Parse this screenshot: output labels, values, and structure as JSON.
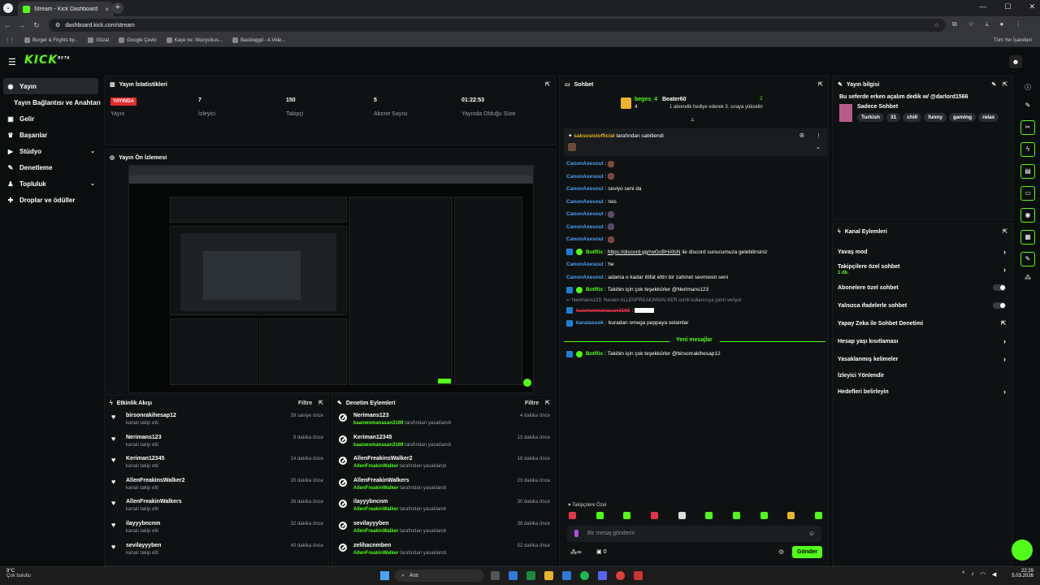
{
  "browser": {
    "tab_title": "Stream - Kick Dashboard",
    "url": "dashboard.kick.com/stream",
    "bookmarks": [
      "Burger & Frights by...",
      "Gözat",
      "Google Çeviri",
      "Kaçe ne: Xkurycikus...",
      "Backloggd - A Vide..."
    ],
    "all_bookmarks": "Tüm Yer İşaretleri"
  },
  "kick": {
    "logo": "KICK",
    "logo_sup": "BETA"
  },
  "sidebar": {
    "items": [
      {
        "label": "Yayın",
        "icon": "broadcast-icon"
      },
      {
        "label": "Yayın Bağlantısı ve Anahtarı"
      },
      {
        "label": "Gelir",
        "icon": "wallet-icon"
      },
      {
        "label": "Başarılar",
        "icon": "trophy-icon"
      },
      {
        "label": "Stüdyo",
        "icon": "video-icon"
      },
      {
        "label": "Denetleme",
        "icon": "wrench-icon"
      },
      {
        "label": "Topluluk",
        "icon": "people-icon"
      },
      {
        "label": "Droplar ve ödüller",
        "icon": "gift-icon"
      }
    ]
  },
  "stats": {
    "title": "Yayın İstatistikleri",
    "items": [
      {
        "value": "YAYINDA",
        "label": "Yayın"
      },
      {
        "value": "7",
        "label": "İzleyici"
      },
      {
        "value": "150",
        "label": "Takipçi"
      },
      {
        "value": "5",
        "label": "Abone Sayısı"
      },
      {
        "value": "01:22:53",
        "label": "Yayında Olduğu Süre"
      }
    ]
  },
  "preview": {
    "title": "Yayın Ön İzlemesi"
  },
  "feed": {
    "title": "Etkinlik Akışı",
    "filter": "Filtre",
    "rows": [
      {
        "name": "birsonrakihesap12",
        "sub": "kanalı takip etti",
        "time": "39 saniye önce"
      },
      {
        "name": "Nerimans123",
        "sub": "kanalı takip etti",
        "time": "8 dakika önce"
      },
      {
        "name": "Keriman12345",
        "sub": "kanalı takip etti",
        "time": "14 dakika önce"
      },
      {
        "name": "AllenFreakinsWalker2",
        "sub": "kanalı takip etti",
        "time": "20 dakika önce"
      },
      {
        "name": "AllenFreakinWalkers",
        "sub": "kanalı takip etti",
        "time": "26 dakika önce"
      },
      {
        "name": "ilayyybncnm",
        "sub": "kanalı takip etti",
        "time": "32 dakika önce"
      },
      {
        "name": "sevilayyyben",
        "sub": "kanalı takip etti",
        "time": "40 dakika önce"
      }
    ]
  },
  "modact": {
    "title": "Denetim Eylemleri",
    "filter": "Filtre",
    "rows": [
      {
        "name": "Nerimans123",
        "by": "kaanwomanasan3169",
        "suffix": "tarafından yasaklandı",
        "time": "4 dakika önce"
      },
      {
        "name": "Keriman12345",
        "by": "kaanwomanasan3169",
        "suffix": "tarafından yasaklandı",
        "time": "13 dakika önce"
      },
      {
        "name": "AllenFreakinsWalker2",
        "by": "AllenFreakinWalker",
        "suffix": "tarafından yasaklandı",
        "time": "18 dakika önce"
      },
      {
        "name": "AllenFreakinWalkers",
        "by": "AllenFreakinWalker",
        "suffix": "tarafından yasaklandı",
        "time": "23 dakika önce"
      },
      {
        "name": "ilayyybncnm",
        "by": "AllenFreakinWalker",
        "suffix": "tarafından yasaklandı",
        "time": "30 dakika önce"
      },
      {
        "name": "sevilayyyben",
        "by": "AllenFreakinWalker",
        "suffix": "tarafından yasaklandı",
        "time": "38 dakika önce"
      },
      {
        "name": "zelihacnmben",
        "by": "AllenFreakinWalker",
        "suffix": "tarafından yasaklandı",
        "time": "52 dakika önce"
      }
    ]
  },
  "chat": {
    "title": "Sohbet",
    "gifter1": "beges_4",
    "gifter1_count": "4",
    "gifter2": "Beater60",
    "gifter2_count": "2",
    "gift_note": "1 abonelik hediye ederek 3. sıraya yükselin",
    "pinned_by": "saksosisiofficial",
    "pinned_suffix": "tarafından sabitlendi",
    "messages": [
      {
        "user": "CanonAxesoul",
        "text": ""
      },
      {
        "user": "CanonAxesoul",
        "text": ""
      },
      {
        "user": "CanonAxesoul",
        "text": "seviyo seni da"
      },
      {
        "user": "CanonAxesoul",
        "text": "reis"
      },
      {
        "user": "CanonAxesoul",
        "text": ""
      },
      {
        "user": "CanonAxesoul",
        "text": ""
      },
      {
        "user": "CanonAxesoul",
        "text": ""
      },
      {
        "user": "BotRix",
        "bot": true,
        "link": "https://discord.gg/rwGcBHAfsN",
        "text": "ile discord sunucumuza gelebilirsiniz"
      },
      {
        "user": "CanonAxesoul",
        "text": "he"
      },
      {
        "user": "CanonAxesoul",
        "text": "adama o kadar iltifat ettin bir zahmet sevmesin seni"
      },
      {
        "user": "BotRix",
        "bot": true,
        "text": "Takibin için çok teşekkürler @Nerimans123"
      }
    ],
    "reply_note": "Nerimans123: Nesten ALLENFREAKINWALKER isimli kullanıcıya yanıt veriyor",
    "banned_user": "kaanwomanasan3169",
    "last_user": "karatassok",
    "last_text": "buradan omega peppaya selamlar",
    "new_messages": "Yeni mesajlar",
    "after_user": "BotRix",
    "after_text": "Takibin için çok teşekkürler @birsonrakihesap12",
    "followers_only": "Takipçilere Özel",
    "input_placeholder": "Bir mesaj gönderin",
    "points": "0",
    "send": "Gönder"
  },
  "info": {
    "title": "Yayın bilgisi",
    "stream_title": "Bu seferde erken açalım dedik w/ @darlord1566",
    "category": "Sadece Sohbet",
    "tags": [
      "Turkish",
      "31",
      "chill",
      "funny",
      "gaming",
      "relax"
    ]
  },
  "actions": {
    "title": "Kanal Eylemleri",
    "items": [
      {
        "label": "Yavaş mod",
        "kind": "arrow"
      },
      {
        "label": "Takipçilere özel sohbet",
        "sub": "1 dk.",
        "kind": "arrow"
      },
      {
        "label": "Abonelere özel sohbet",
        "kind": "toggle"
      },
      {
        "label": "Yalnızca ifadelerle sohbet",
        "kind": "toggle"
      },
      {
        "label": "Yapay Zeka ile Sohbet Denetimi",
        "kind": "ext"
      },
      {
        "label": "Hesap yaşı kısıtlaması",
        "kind": "arrow"
      },
      {
        "label": "Yasaklanmış kelimeler",
        "kind": "arrow"
      },
      {
        "label": "İzleyici Yönlendir",
        "kind": "none"
      },
      {
        "label": "Hedefleri belirleyin",
        "kind": "arrow"
      }
    ]
  },
  "taskbar": {
    "temp": "9°C",
    "weather": "Çok bulutlu",
    "search": "Ara",
    "time": "22:29",
    "date": "5.03.2026"
  }
}
